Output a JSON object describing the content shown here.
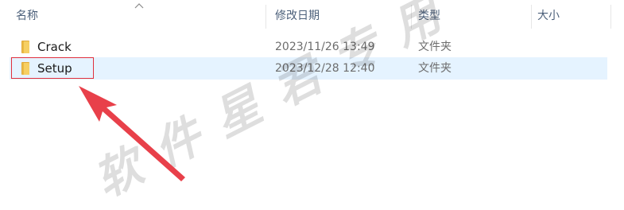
{
  "columns": {
    "name": "名称",
    "modified": "修改日期",
    "type": "类型",
    "size": "大小"
  },
  "files": [
    {
      "name": "Crack",
      "modified": "2023/11/26 13:49",
      "type": "文件夹",
      "icon": "folder-icon",
      "selected": false
    },
    {
      "name": "Setup",
      "modified": "2023/12/28 12:40",
      "type": "文件夹",
      "icon": "folder-icon",
      "selected": true
    }
  ],
  "annotation": {
    "highlight_color": "#e0303d",
    "arrow_color": "#e8404a"
  },
  "watermark": {
    "text": "软件星君专用"
  },
  "colors": {
    "header_text": "#4c607a",
    "selected_row": "#e5f3ff",
    "folder": "#f2c55a"
  }
}
